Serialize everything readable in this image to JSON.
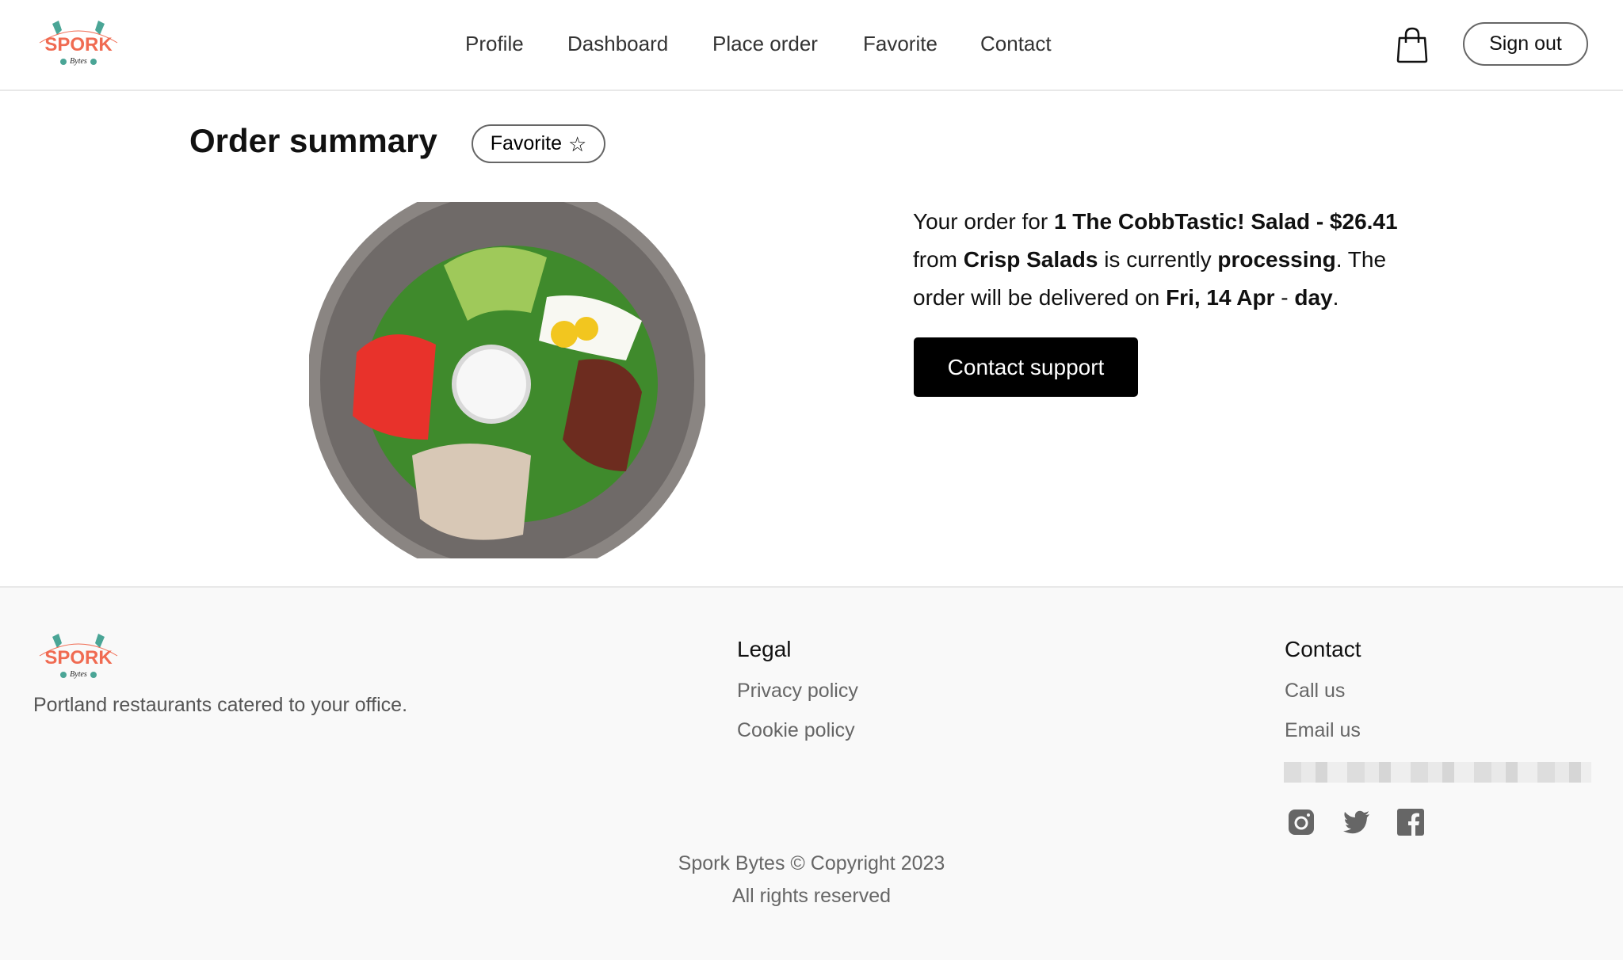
{
  "brand": {
    "name": "Spork Bytes",
    "logo_text": "SPORK",
    "logo_subtext": "Bytes",
    "accent_color": "#f06b52",
    "secondary_color": "#4aa596"
  },
  "nav": {
    "items": [
      {
        "label": "Profile"
      },
      {
        "label": "Dashboard"
      },
      {
        "label": "Place order"
      },
      {
        "label": "Favorite"
      },
      {
        "label": "Contact"
      }
    ],
    "cart_icon": "shopping-bag-icon",
    "sign_out_label": "Sign out"
  },
  "main": {
    "title": "Order summary",
    "favorite_label": "Favorite",
    "favorite_icon": "star-outline-icon",
    "image_alt": "Cobb salad in a steel bowl",
    "order": {
      "prefix": "Your order for ",
      "item": "1 The CobbTastic! Salad - $26.41",
      "from_text": " from ",
      "restaurant": "Crisp Salads",
      "status_text": " is currently ",
      "status": "processing",
      "delivery_text": ". The order will be delivered on ",
      "delivery_date": "Fri, 14 Apr",
      "separator": " - ",
      "delivery_time": "day",
      "end": "."
    },
    "contact_support_label": "Contact support"
  },
  "footer": {
    "tagline": "Portland restaurants catered to your office.",
    "legal": {
      "heading": "Legal",
      "links": [
        "Privacy policy",
        "Cookie policy"
      ]
    },
    "contact": {
      "heading": "Contact",
      "links": [
        "Call us",
        "Email us"
      ],
      "social": [
        "instagram-icon",
        "twitter-icon",
        "facebook-icon"
      ]
    },
    "copyright": "Spork Bytes © Copyright 2023",
    "rights": "All rights reserved"
  }
}
